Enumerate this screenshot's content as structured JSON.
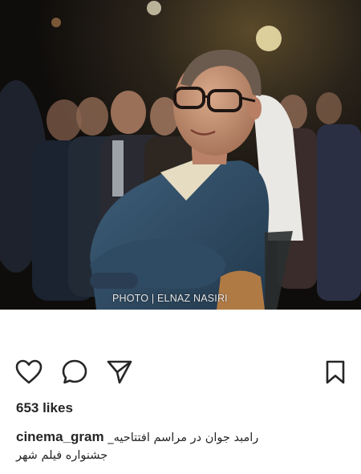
{
  "post": {
    "photo_credit": "PHOTO | ELNAZ NASIRI",
    "likes_text": "653 likes",
    "username": "cinema_gram",
    "caption_line1": "_رامبد جوان در مراسم افتتاحیه",
    "caption_line2": "جشنواره فیلم شهر"
  },
  "icons": {
    "like": "heart-icon",
    "comment": "comment-icon",
    "share": "send-icon",
    "save": "bookmark-icon"
  },
  "colors": {
    "text": "#262626",
    "background": "#ffffff"
  }
}
